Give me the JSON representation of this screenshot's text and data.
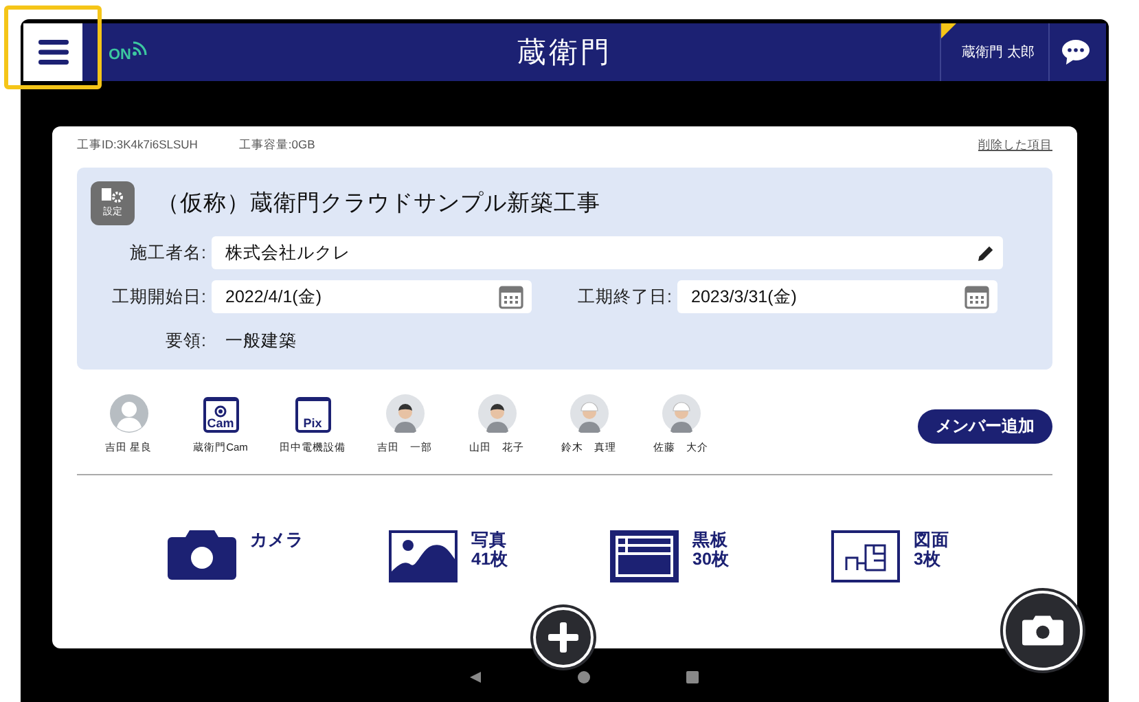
{
  "header": {
    "status": "ON",
    "logo": "蔵衛門",
    "user": "蔵衛門 太郎"
  },
  "project": {
    "id_label": "工事ID:3K4k7i6SLSUH",
    "capacity_label": "工事容量:0GB",
    "deleted_link": "削除した項目",
    "settings_label": "設定",
    "title": "（仮称）蔵衛門クラウドサンプル新築工事",
    "contractor": {
      "label": "施工者名:",
      "value": "株式会社ルクレ"
    },
    "start": {
      "label": "工期開始日:",
      "value": "2022/4/1(金)"
    },
    "end": {
      "label": "工期終了日:",
      "value": "2023/3/31(金)"
    },
    "outline": {
      "label": "要領:",
      "value": "一般建築"
    }
  },
  "members": [
    {
      "kind": "blank",
      "name": "吉田 星良"
    },
    {
      "kind": "device",
      "badge": "Cam",
      "name": "蔵衛門Cam"
    },
    {
      "kind": "device",
      "badge": "Pix",
      "name": "田中電機設備"
    },
    {
      "kind": "person",
      "name": "吉田　一部"
    },
    {
      "kind": "person",
      "name": "山田　花子"
    },
    {
      "kind": "helmet",
      "name": "鈴木　真理"
    },
    {
      "kind": "helmet",
      "name": "佐藤　大介"
    }
  ],
  "add_member": "メンバー追加",
  "actions": [
    {
      "kind": "camera",
      "label": "カメラ"
    },
    {
      "kind": "photo",
      "label": "写真",
      "count": "41枚"
    },
    {
      "kind": "board",
      "label": "黒板",
      "count": "30枚"
    },
    {
      "kind": "drawing",
      "label": "図面",
      "count": "3枚"
    }
  ]
}
